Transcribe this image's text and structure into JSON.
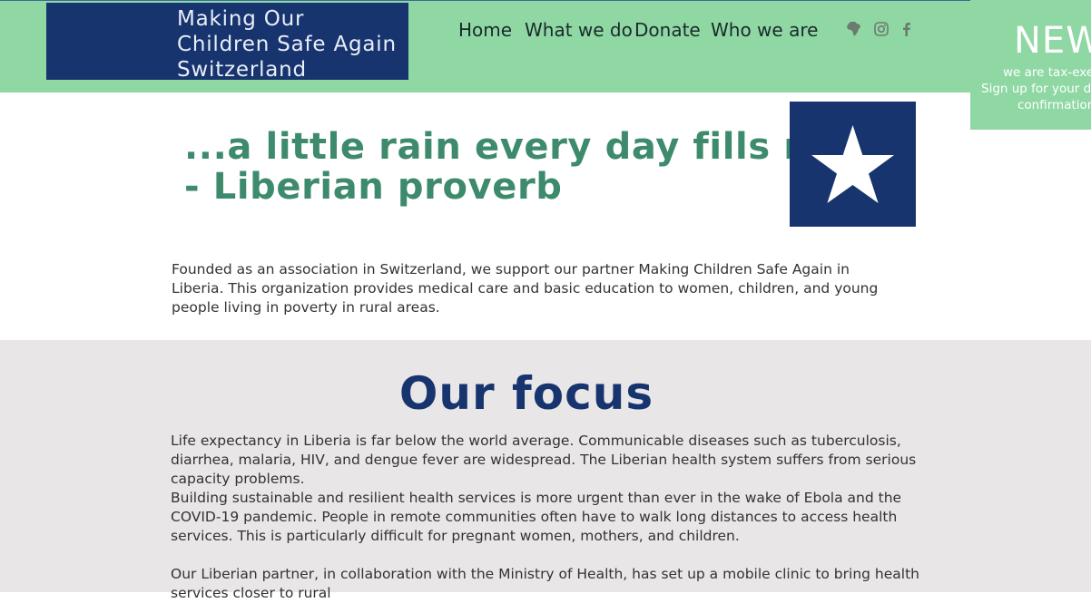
{
  "header": {
    "logo_text": "Making Our Children Safe Again Switzerland",
    "nav": [
      {
        "label": "Home"
      },
      {
        "label": "What we do"
      },
      {
        "label": "Donate"
      },
      {
        "label": "Who we are"
      }
    ],
    "social_icons": [
      "africa-map-icon",
      "instagram-icon",
      "facebook-icon"
    ],
    "colors": {
      "header_bg": "#8fd8a4",
      "logo_bg": "#17346e"
    }
  },
  "promo": {
    "title": "NEW",
    "line1": "we are tax-exem",
    "line2": "Sign up  for your  do",
    "line3": "confirmation"
  },
  "quote": {
    "line1": "...a little rain every day fills rivers.",
    "line2": "- Liberian proverb"
  },
  "flag": {
    "icon": "star-icon",
    "color": "#17346e"
  },
  "intro": {
    "text": "Founded as an association in Switzerland, we support our partner Making Children Safe Again in Liberia. This organization provides medical care and basic education to women, children, and young people living in poverty in rural areas."
  },
  "focus": {
    "title": "Our focus",
    "paragraphs": [
      "Life expectancy in Liberia is far below the world average. Communicable diseases such as tuberculosis, diarrhea, malaria, HIV, and dengue fever are widespread. The Liberian health system suffers from serious capacity problems.",
      "Building sustainable and resilient health services is more urgent than ever in the wake of Ebola and the COVID-19 pandemic. People in remote communities often have to walk long distances to access health services. This is particularly difficult for pregnant women, mothers, and children.",
      "Our Liberian partner, in collaboration with the Ministry of Health, has set up a mobile clinic to bring health services closer to rural"
    ]
  }
}
